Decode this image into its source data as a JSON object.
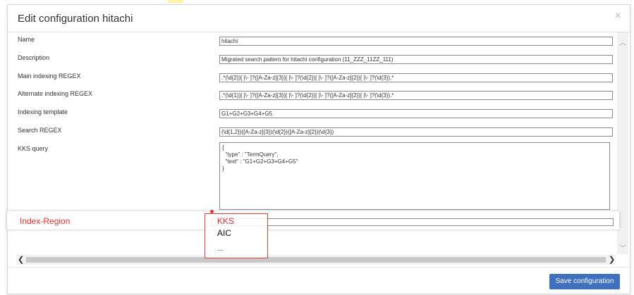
{
  "dialog": {
    "title": "Edit configuration hitachi",
    "close_glyph": "×"
  },
  "form": {
    "fields": [
      {
        "label": "Name",
        "value": "hitachi"
      },
      {
        "label": "Description",
        "value": "Migrated search pattern for hitachi configuration (11_ZZZ_11ZZ_111)"
      },
      {
        "label": "Main indexing REGEX",
        "value": ".*(\\d{2})[ |\\- ]?([A-Za-z]{3})[ |\\- ]?(\\d{2})[ |\\- ]?([A-Za-z]{2})[ |\\- ]?(\\d{3}).*"
      },
      {
        "label": "Alternate indexing REGEX",
        "value": ".*(\\d{1})[ |\\- ]?([A-Za-z]{3})[ |\\- ]?(\\d{2})[ |\\- ]?([A-Za-z]{2})[ |\\- ]?(\\d{3}).*"
      },
      {
        "label": "Indexing template",
        "value": "G1+G2+G3+G4+G5"
      },
      {
        "label": "Search REGEX",
        "value": "(\\d{1,2})([A-Za-z]{3})(\\d{2})([A-Za-z]{2})(\\d{3})"
      }
    ],
    "kks": {
      "label": "KKS query",
      "value": "{\n  \"type\" : \"TermQuery\",\n  \"text\" : \"G1+G2+G3+G4+G5\"\n}"
    },
    "index_region": {
      "label": "Index-Region",
      "options": [
        "KKS",
        "AIC",
        "..."
      ]
    }
  },
  "footer": {
    "save_label": "Save configuration"
  },
  "colors": {
    "primary_button": "#3f6fbf",
    "annotation_red": "#e53030"
  }
}
